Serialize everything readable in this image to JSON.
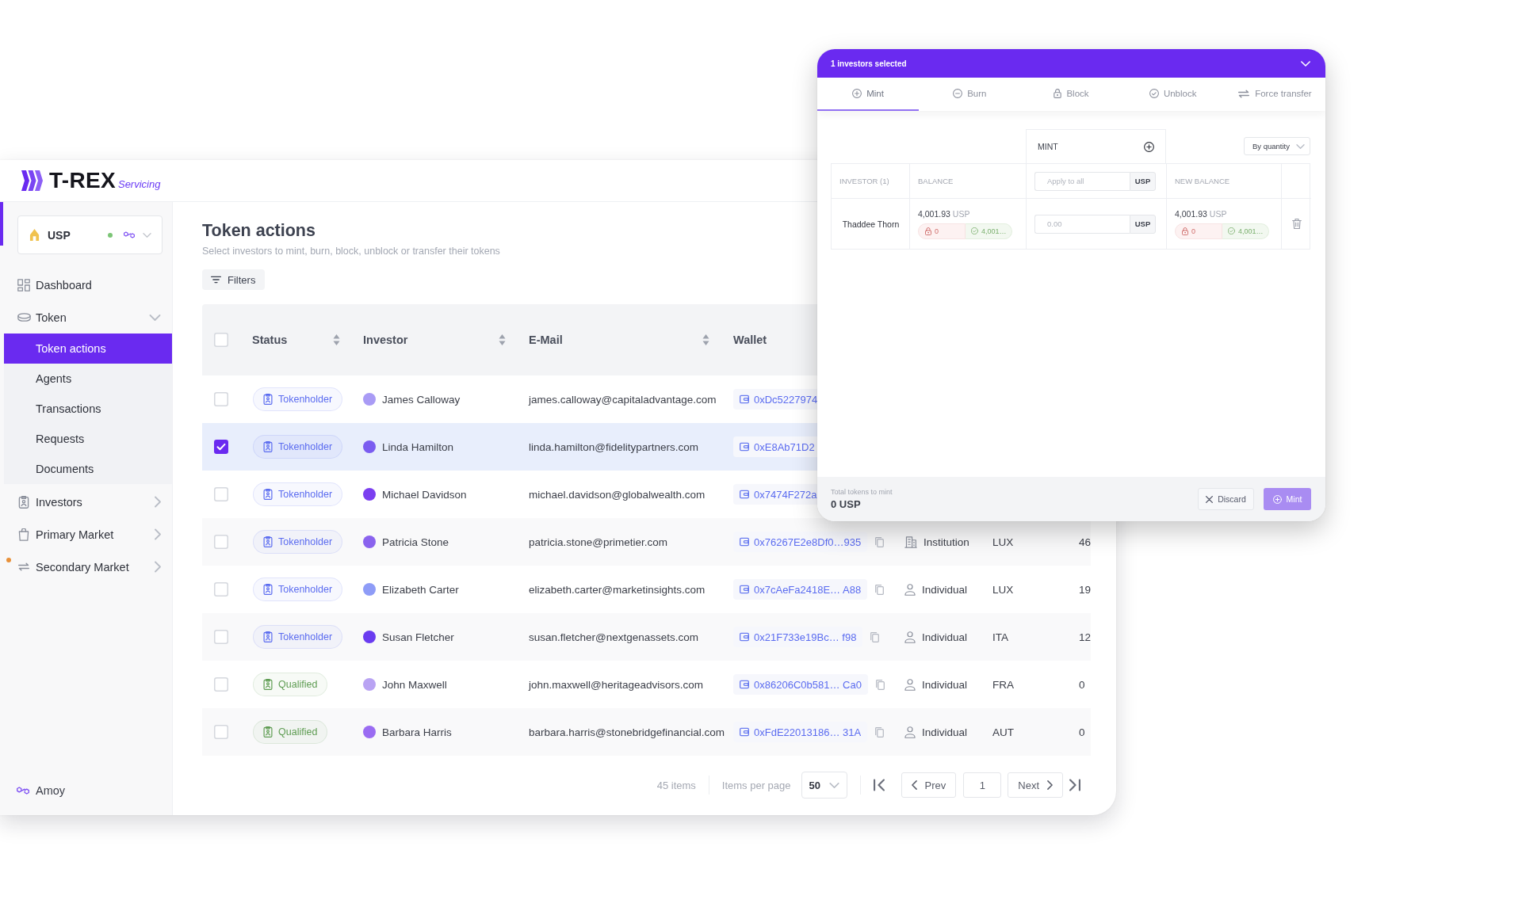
{
  "app": {
    "logo": {
      "name": "T-REX",
      "tagline": "Servicing"
    }
  },
  "sidebar": {
    "token_selector": {
      "symbol": "USP",
      "connected": true
    },
    "items": [
      {
        "kind": "link",
        "label": "Dashboard",
        "selected": false,
        "notification": false
      },
      {
        "kind": "group",
        "label": "Token",
        "selected": false,
        "notification": false,
        "expanded": true,
        "children": [
          {
            "label": "Token actions",
            "selected": true
          },
          {
            "label": "Agents",
            "selected": false
          },
          {
            "label": "Transactions",
            "selected": false
          },
          {
            "label": "Requests",
            "selected": false
          },
          {
            "label": "Documents",
            "selected": false
          }
        ]
      },
      {
        "kind": "group",
        "label": "Investors",
        "selected": false,
        "notification": false,
        "expanded": false
      },
      {
        "kind": "group",
        "label": "Primary Market",
        "selected": false,
        "notification": false,
        "expanded": false
      },
      {
        "kind": "group",
        "label": "Secondary Market",
        "selected": false,
        "notification": true,
        "expanded": false
      }
    ],
    "network": "Amoy"
  },
  "page": {
    "title": "Token actions",
    "subtitle": "Select investors to mint, burn, block, unblock or transfer their tokens",
    "filters_button": "Filters"
  },
  "table": {
    "select_all": {
      "checked": false
    },
    "columns": [
      {
        "label": "Status",
        "sortable": true
      },
      {
        "label": "Investor",
        "sortable": true
      },
      {
        "label": "E-Mail",
        "sortable": true
      },
      {
        "label": "Wallet",
        "sortable": false
      }
    ],
    "rows": [
      {
        "selected": false,
        "status": {
          "label": "Tokenholder",
          "color": "#5b6cf0"
        },
        "investor": {
          "name": "James Calloway",
          "color": "#a99bf5"
        },
        "email": "james.calloway@capitaladvantage.com",
        "wallet": "0xDc5227974"
      },
      {
        "selected": true,
        "status": {
          "label": "Tokenholder",
          "color": "#5b6cf0"
        },
        "investor": {
          "name": "Linda Hamilton",
          "color": "#7a5cf0"
        },
        "email": "linda.hamilton@fidelitypartners.com",
        "wallet": "0xE8Ab71D2"
      },
      {
        "selected": false,
        "status": {
          "label": "Tokenholder",
          "color": "#5b6cf0"
        },
        "investor": {
          "name": "Michael Davidson",
          "color": "#7b3ff0"
        },
        "email": "michael.davidson@globalwealth.com",
        "wallet": "0x7474F272a"
      },
      {
        "selected": false,
        "status": {
          "label": "Tokenholder",
          "color": "#5b6cf0"
        },
        "investor": {
          "name": "Patricia Stone",
          "color": "#8a63ee"
        },
        "email": "patricia.stone@primetier.com",
        "wallet": "0x76267E2e8Df0…935",
        "column_6": {
          "kind": "institution",
          "label": "Institution"
        },
        "column_7": "LUX",
        "column_8": "46"
      },
      {
        "selected": false,
        "status": {
          "label": "Tokenholder",
          "color": "#5b6cf0"
        },
        "investor": {
          "name": "Elizabeth Carter",
          "color": "#8e9cf7"
        },
        "email": "elizabeth.carter@marketinsights.com",
        "wallet": "0x7cAeFa2418E… A88",
        "column_6": {
          "kind": "individual",
          "label": "Individual"
        },
        "column_7": "LUX",
        "column_8": "19"
      },
      {
        "selected": false,
        "status": {
          "label": "Tokenholder",
          "color": "#5b6cf0"
        },
        "investor": {
          "name": "Susan Fletcher",
          "color": "#6a3cf0"
        },
        "email": "susan.fletcher@nextgenassets.com",
        "wallet": "0x21F733e19Bc… f98",
        "column_6": {
          "kind": "individual",
          "label": "Individual"
        },
        "column_7": "ITA",
        "column_8": "12"
      },
      {
        "selected": false,
        "status": {
          "label": "Qualified",
          "color": "#5e9c52"
        },
        "investor": {
          "name": "John Maxwell",
          "color": "#b9a3f3"
        },
        "email": "john.maxwell@heritageadvisors.com",
        "wallet": "0x86206C0b581… Ca0",
        "column_6": {
          "kind": "individual",
          "label": "Individual"
        },
        "column_7": "FRA",
        "column_8": "0"
      },
      {
        "selected": false,
        "status": {
          "label": "Qualified",
          "color": "#5e9c52"
        },
        "investor": {
          "name": "Barbara Harris",
          "color": "#9a6cf2"
        },
        "email": "barbara.harris@stonebridgefinancial.com",
        "wallet": "0xFdE22013186… 31A",
        "column_6": {
          "kind": "individual",
          "label": "Individual"
        },
        "column_7": "AUT",
        "column_8": "0"
      }
    ]
  },
  "pagination": {
    "total": "45 items",
    "per_page_label": "Items per page",
    "per_page": "50",
    "prev": "Prev",
    "page": "1",
    "next": "Next"
  },
  "action_panel": {
    "title": "1 investors selected",
    "tabs": [
      {
        "label": "Mint",
        "selected": true
      },
      {
        "label": "Burn",
        "selected": false
      },
      {
        "label": "Block",
        "selected": false
      },
      {
        "label": "Unblock",
        "selected": false
      },
      {
        "label": "Force transfer",
        "selected": false
      }
    ],
    "mint_header": "MINT",
    "mode_select": "By quantity",
    "columns": [
      "INVESTOR (1)",
      "BALANCE",
      "NEW BALANCE"
    ],
    "apply_all": {
      "placeholder": "Apply to all",
      "unit": "USP"
    },
    "rows": [
      {
        "investor": "Thaddee Thorn",
        "balance": {
          "amount": "4,001.93",
          "unit": "USP",
          "locked": "0",
          "available": "4,001…"
        },
        "amount_field": {
          "placeholder": "0.00",
          "unit": "USP"
        },
        "new_balance": {
          "amount": "4,001.93",
          "unit": "USP",
          "locked": "0",
          "available": "4,001…"
        }
      }
    ],
    "footer": {
      "total_label": "Total tokens to mint",
      "total": "0 USP",
      "discard": "Discard",
      "confirm": {
        "label": "Mint",
        "disabled": true
      }
    }
  }
}
